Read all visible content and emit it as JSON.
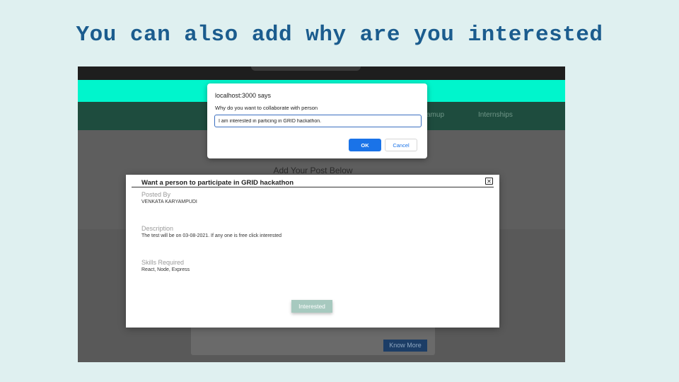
{
  "slide": {
    "title": "You can also add why are you interested"
  },
  "navbar": {
    "links": [
      "amup",
      "Internships"
    ]
  },
  "page": {
    "heading": "Add Your Post Below",
    "know_more_label": "Know More"
  },
  "alert": {
    "title": "localhost:3000 says",
    "message": "Why do you want to collaborate with person",
    "input_value": "I am interested in particing in GRID hackathon.",
    "ok_label": "OK",
    "cancel_label": "Cancel",
    "ok_color": "#1a73e8"
  },
  "modal": {
    "title": "Want a person to participate in GRID hackathon",
    "close_glyph": "✕",
    "posted_by_label": "Posted By",
    "posted_by_value": "VENKATA KARYAMPUDI",
    "description_label": "Description",
    "description_value": "The test will be on 03-08-2021. If any one is free click interested",
    "skills_label": "Skills Required",
    "skills_value": "React, Node, Express",
    "interested_label": "Interested",
    "interested_color": "#a7c9bf"
  },
  "colors": {
    "slide_background": "#dff0f0",
    "title_color": "#1b5c8e",
    "teal_bar": "#00f5cc",
    "navbar": "#1e4c3e"
  }
}
